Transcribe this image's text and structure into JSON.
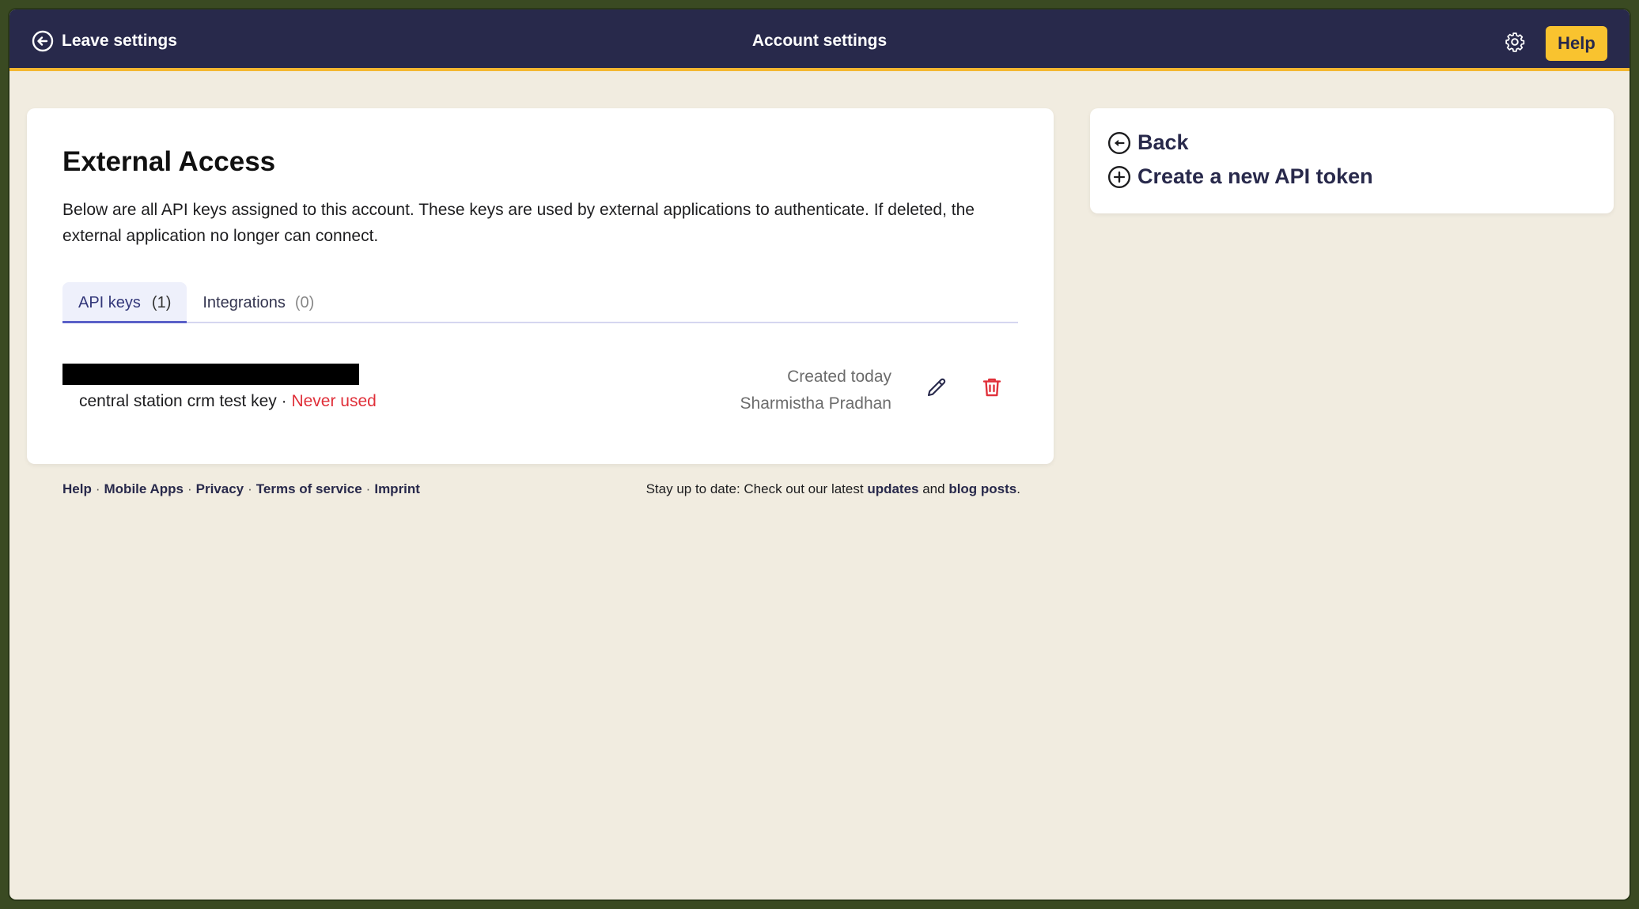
{
  "header": {
    "leave_label": "Leave settings",
    "title": "Account settings",
    "help_label": "Help"
  },
  "main": {
    "title": "External Access",
    "description": "Below are all API keys assigned to this account. These keys are used by external applications to authenticate. If deleted, the external application no longer can connect.",
    "tabs": [
      {
        "label": "API keys",
        "count": "(1)"
      },
      {
        "label": "Integrations",
        "count": "(0)"
      }
    ],
    "key": {
      "name": "central station crm test key",
      "separator": " · ",
      "usage": "Never used",
      "created": "Created today",
      "owner": "Sharmistha Pradhan"
    }
  },
  "footer": {
    "links": [
      "Help",
      "Mobile Apps",
      "Privacy",
      "Terms of service",
      "Imprint"
    ],
    "stay_prefix": "Stay up to date: Check out our latest ",
    "updates": "updates",
    "and": " and ",
    "blog": "blog posts",
    "suffix": "."
  },
  "side": {
    "back_label": "Back",
    "create_label": "Create a new API token"
  },
  "colors": {
    "header_bg": "#28294b",
    "accent": "#f9c32f",
    "danger": "#e0303a",
    "page_bg": "#f1ece0"
  }
}
